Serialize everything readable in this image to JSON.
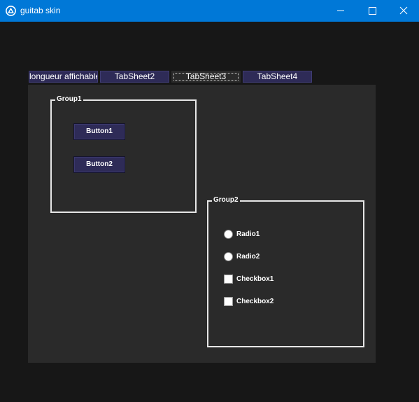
{
  "window": {
    "title": "guitab skin",
    "icon": "app-logo-icon",
    "controls": [
      "minimize-icon",
      "maximize-icon",
      "close-icon"
    ],
    "titlebar_color": "#0078d7",
    "background_color": "#171717"
  },
  "tabs": [
    {
      "label": "longueur affichable",
      "selected": false
    },
    {
      "label": "TabSheet2",
      "selected": false
    },
    {
      "label": "TabSheet3",
      "selected": true
    },
    {
      "label": "TabSheet4",
      "selected": false
    }
  ],
  "group1": {
    "title": "Group1",
    "buttons": [
      {
        "label": "Button1"
      },
      {
        "label": "Button2"
      }
    ]
  },
  "group2": {
    "title": "Group2",
    "radios": [
      {
        "label": "Radio1",
        "checked": false
      },
      {
        "label": "Radio2",
        "checked": false
      }
    ],
    "checkboxes": [
      {
        "label": "Checkbox1",
        "checked": false
      },
      {
        "label": "Checkbox2",
        "checked": false
      }
    ]
  },
  "colors": {
    "tab_fill": "#2e2b57",
    "button_fill": "#2e2b57",
    "page_background": "#2a2a2a",
    "group_border": "#e6e6e6"
  }
}
